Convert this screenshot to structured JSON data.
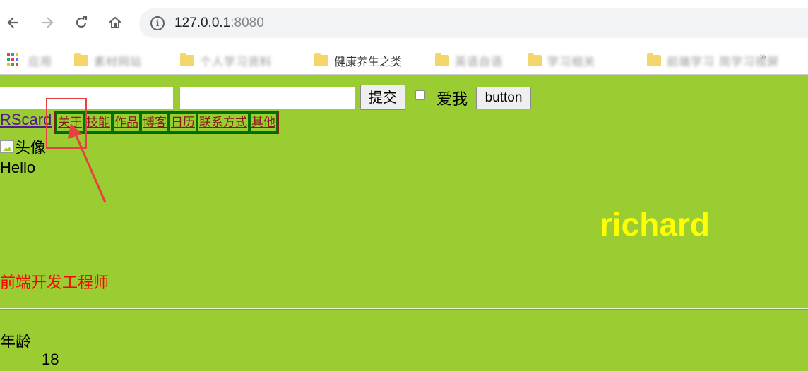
{
  "browser": {
    "nav": {
      "back_icon": "arrow-left-icon",
      "forward_icon": "arrow-right-icon",
      "reload_icon": "reload-icon",
      "home_icon": "home-icon"
    },
    "url_host": "127.0.0.1",
    "url_port": ":8080",
    "bookmarks": {
      "apps_label": "应用",
      "items": [
        "素材网站",
        "个人学习资料",
        "健康养生之类",
        "英语自语",
        "学习相关",
        "前端学习 简学习视屏"
      ]
    }
  },
  "form": {
    "submit_label": "提交",
    "checkbox_label": "爱我",
    "button_label": "button"
  },
  "header": {
    "brand": "RScard",
    "nav_items": [
      "关于",
      "技能",
      "作品",
      "博客",
      "日历",
      "联系方式",
      "其他"
    ]
  },
  "profile": {
    "avatar_alt": "头像",
    "greeting": "Hello",
    "name": "richard",
    "role": "前端开发工程师",
    "age_label": "年龄",
    "age_value": "18"
  },
  "colors": {
    "page_bg": "#9acd32",
    "name_color": "#ffff00",
    "role_color": "#ff0000",
    "annotation": "#e84040"
  }
}
